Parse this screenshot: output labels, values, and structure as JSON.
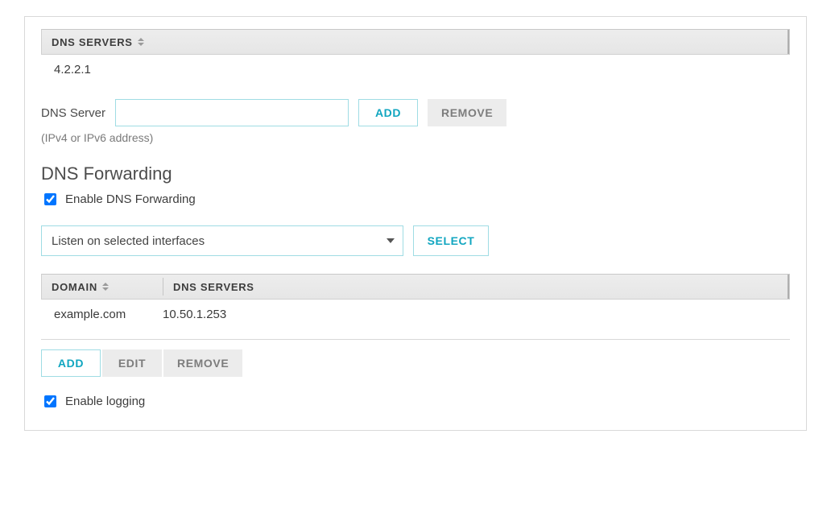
{
  "dns_table": {
    "header": "DNS SERVERS",
    "rows": [
      "4.2.2.1"
    ]
  },
  "dns_form": {
    "label": "DNS Server",
    "value": "",
    "placeholder": "",
    "help": "(IPv4 or IPv6 address)",
    "add": "ADD",
    "remove": "REMOVE"
  },
  "forwarding": {
    "title": "DNS Forwarding",
    "enable_label": "Enable DNS Forwarding",
    "enable_checked": true,
    "listen_selected": "Listen on selected interfaces",
    "select_btn": "SELECT"
  },
  "domain_table": {
    "col_domain": "DOMAIN",
    "col_servers": "DNS SERVERS",
    "rows": [
      {
        "domain": "example.com",
        "servers": "10.50.1.253"
      }
    ]
  },
  "domain_actions": {
    "add": "ADD",
    "edit": "EDIT",
    "remove": "REMOVE"
  },
  "logging": {
    "label": "Enable logging",
    "checked": true
  }
}
